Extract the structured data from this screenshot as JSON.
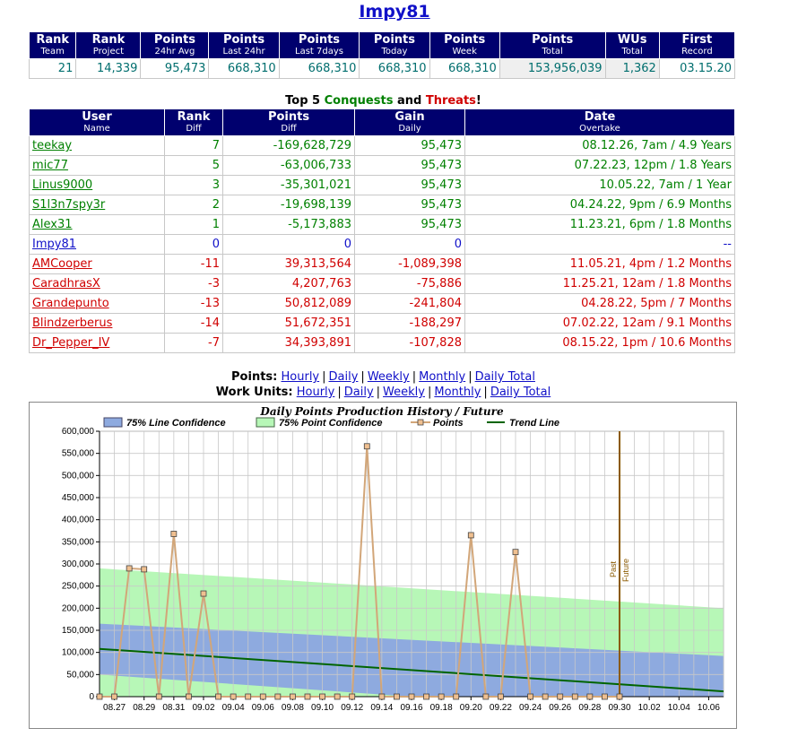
{
  "page": {
    "title": "Impy81"
  },
  "stats": {
    "headers": [
      {
        "label": "Rank",
        "sub": "Team"
      },
      {
        "label": "Rank",
        "sub": "Project"
      },
      {
        "label": "Points",
        "sub": "24hr Avg"
      },
      {
        "label": "Points",
        "sub": "Last 24hr"
      },
      {
        "label": "Points",
        "sub": "Last 7days"
      },
      {
        "label": "Points",
        "sub": "Today"
      },
      {
        "label": "Points",
        "sub": "Week"
      },
      {
        "label": "Points",
        "sub": "Total"
      },
      {
        "label": "WUs",
        "sub": "Total"
      },
      {
        "label": "First",
        "sub": "Record"
      }
    ],
    "values": [
      "21",
      "14,339",
      "95,473",
      "668,310",
      "668,310",
      "668,310",
      "668,310",
      "153,956,039",
      "1,362",
      "03.15.20"
    ]
  },
  "top5": {
    "prefix": "Top 5 ",
    "conquests": "Conquests",
    "and": " and ",
    "threats": "Threats",
    "suffix": "!"
  },
  "rank_table": {
    "headers": [
      {
        "label": "User",
        "sub": "Name"
      },
      {
        "label": "Rank",
        "sub": "Diff"
      },
      {
        "label": "Points",
        "sub": "Diff"
      },
      {
        "label": "Gain",
        "sub": "Daily"
      },
      {
        "label": "Date",
        "sub": "Overtake"
      }
    ],
    "rows": [
      {
        "name": "teekay",
        "rank": "7",
        "points": "-169,628,729",
        "gain": "95,473",
        "date": "08.12.26, 7am / 4.9 Years",
        "color": "g"
      },
      {
        "name": "mic77",
        "rank": "5",
        "points": "-63,006,733",
        "gain": "95,473",
        "date": "07.22.23, 12pm / 1.8 Years",
        "color": "g"
      },
      {
        "name": "Linus9000",
        "rank": "3",
        "points": "-35,301,021",
        "gain": "95,473",
        "date": "10.05.22, 7am / 1 Year",
        "color": "g"
      },
      {
        "name": "S1l3n7spy3r",
        "rank": "2",
        "points": "-19,698,139",
        "gain": "95,473",
        "date": "04.24.22, 9pm / 6.9 Months",
        "color": "g"
      },
      {
        "name": "Alex31",
        "rank": "1",
        "points": "-5,173,883",
        "gain": "95,473",
        "date": "11.23.21, 6pm / 1.8 Months",
        "color": "g"
      },
      {
        "name": "Impy81",
        "rank": "0",
        "points": "0",
        "gain": "0",
        "date": "--",
        "color": "b"
      },
      {
        "name": "AMCooper",
        "rank": "-11",
        "points": "39,313,564",
        "gain": "-1,089,398",
        "date": "11.05.21, 4pm / 1.2 Months",
        "color": "r"
      },
      {
        "name": "CaradhrasX",
        "rank": "-3",
        "points": "4,207,763",
        "gain": "-75,886",
        "date": "11.25.21, 12am / 1.8 Months",
        "color": "r"
      },
      {
        "name": "Grandepunto",
        "rank": "-13",
        "points": "50,812,089",
        "gain": "-241,804",
        "date": "04.28.22, 5pm / 7 Months",
        "color": "r"
      },
      {
        "name": "Blindzerberus",
        "rank": "-14",
        "points": "51,672,351",
        "gain": "-188,297",
        "date": "07.02.22, 12am / 9.1 Months",
        "color": "r"
      },
      {
        "name": "Dr_Pepper_IV",
        "rank": "-7",
        "points": "34,393,891",
        "gain": "-107,828",
        "date": "08.15.22, 1pm / 10.6 Months",
        "color": "r"
      }
    ]
  },
  "links": {
    "points_label": "Points:",
    "wu_label": "Work Units:",
    "items": [
      "Hourly",
      "Daily",
      "Weekly",
      "Monthly",
      "Daily Total"
    ],
    "separator": "|"
  },
  "chart_data": {
    "type": "line",
    "title": "Daily Points Production History / Future",
    "legend": [
      "75% Line Confidence",
      "75% Point Confidence",
      "Points",
      "Trend Line"
    ],
    "legend_position": "top",
    "colors": {
      "line_conf": "#8eaadf",
      "point_conf": "#b7f7b7",
      "points": "#d2a679",
      "trend": "#006400",
      "divider": "#8b5a00"
    },
    "ylim": [
      0,
      600000
    ],
    "yticks": [
      "0",
      "50,000",
      "100,000",
      "150,000",
      "200,000",
      "250,000",
      "300,000",
      "350,000",
      "400,000",
      "450,000",
      "500,000",
      "550,000",
      "600,000"
    ],
    "x_dates": [
      "08.26",
      "08.27",
      "08.28",
      "08.29",
      "08.30",
      "08.31",
      "09.01",
      "09.02",
      "09.03",
      "09.04",
      "09.05",
      "09.06",
      "09.07",
      "09.08",
      "09.09",
      "09.10",
      "09.11",
      "09.12",
      "09.13",
      "09.14",
      "09.15",
      "09.16",
      "09.17",
      "09.18",
      "09.19",
      "09.20",
      "09.21",
      "09.22",
      "09.23",
      "09.24",
      "09.25",
      "09.26",
      "09.27",
      "09.28",
      "09.29",
      "09.30",
      "10.01",
      "10.02",
      "10.03",
      "10.04",
      "10.05",
      "10.06",
      "10.07"
    ],
    "xtick_labels": [
      "08.27",
      "08.29",
      "08.31",
      "09.02",
      "09.04",
      "09.06",
      "09.08",
      "09.10",
      "09.12",
      "09.14",
      "09.16",
      "09.18",
      "09.20",
      "09.22",
      "09.24",
      "09.26",
      "09.28",
      "09.30",
      "10.02",
      "10.04",
      "10.06"
    ],
    "points": [
      {
        "x": "08.26",
        "y": 0
      },
      {
        "x": "08.27",
        "y": 0
      },
      {
        "x": "08.28",
        "y": 290000
      },
      {
        "x": "08.29",
        "y": 288000
      },
      {
        "x": "08.30",
        "y": 0
      },
      {
        "x": "08.31",
        "y": 368000
      },
      {
        "x": "09.01",
        "y": 0
      },
      {
        "x": "09.02",
        "y": 233000
      },
      {
        "x": "09.03",
        "y": 0
      },
      {
        "x": "09.04",
        "y": 0
      },
      {
        "x": "09.05",
        "y": 0
      },
      {
        "x": "09.06",
        "y": 0
      },
      {
        "x": "09.07",
        "y": 0
      },
      {
        "x": "09.08",
        "y": 0
      },
      {
        "x": "09.09",
        "y": 0
      },
      {
        "x": "09.10",
        "y": 0
      },
      {
        "x": "09.11",
        "y": 0
      },
      {
        "x": "09.12",
        "y": 0
      },
      {
        "x": "09.13",
        "y": 566000
      },
      {
        "x": "09.14",
        "y": 0
      },
      {
        "x": "09.15",
        "y": 0
      },
      {
        "x": "09.16",
        "y": 0
      },
      {
        "x": "09.17",
        "y": 0
      },
      {
        "x": "09.18",
        "y": 0
      },
      {
        "x": "09.19",
        "y": 0
      },
      {
        "x": "09.20",
        "y": 365000
      },
      {
        "x": "09.21",
        "y": 0
      },
      {
        "x": "09.22",
        "y": 0
      },
      {
        "x": "09.23",
        "y": 327000
      },
      {
        "x": "09.24",
        "y": 0
      },
      {
        "x": "09.25",
        "y": 0
      },
      {
        "x": "09.26",
        "y": 0
      },
      {
        "x": "09.27",
        "y": 0
      },
      {
        "x": "09.28",
        "y": 0
      },
      {
        "x": "09.29",
        "y": 0
      },
      {
        "x": "09.30",
        "y": 0
      }
    ],
    "trend": {
      "start": {
        "x": "08.26",
        "y": 108000
      },
      "end": {
        "x": "10.07",
        "y": 12000
      }
    },
    "line_confidence": {
      "upper_start": 165000,
      "upper_end": 92000,
      "lower_start": 50000,
      "lower_end": 0,
      "lower_zero_at": "09.16"
    },
    "point_confidence": {
      "upper_start": 290000,
      "upper_end": 200000
    },
    "divider": {
      "x": "09.30",
      "label_past": "Past",
      "label_future": "Future"
    }
  }
}
